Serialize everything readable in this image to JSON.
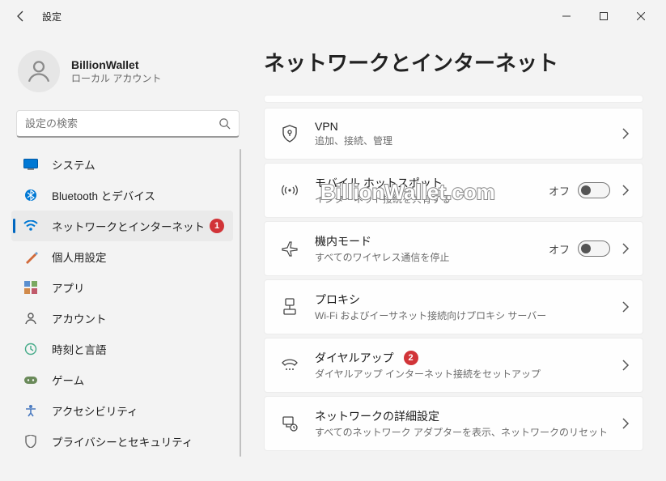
{
  "app": {
    "title": "設定"
  },
  "user": {
    "name": "BillionWallet",
    "type": "ローカル アカウント"
  },
  "search": {
    "placeholder": "設定の検索"
  },
  "sidebar": {
    "items": [
      {
        "label": "システム"
      },
      {
        "label": "Bluetooth とデバイス"
      },
      {
        "label": "ネットワークとインターネット",
        "selected": true,
        "marker": "1"
      },
      {
        "label": "個人用設定"
      },
      {
        "label": "アプリ"
      },
      {
        "label": "アカウント"
      },
      {
        "label": "時刻と言語"
      },
      {
        "label": "ゲーム"
      },
      {
        "label": "アクセシビリティ"
      },
      {
        "label": "プライバシーとセキュリティ"
      }
    ]
  },
  "page": {
    "title": "ネットワークとインターネット"
  },
  "cards": [
    {
      "title": "VPN",
      "desc": "追加、接続、管理"
    },
    {
      "title": "モバイル ホットスポット",
      "desc": "インターネット接続を共有する",
      "toggle": true,
      "toggle_label": "オフ"
    },
    {
      "title": "機内モード",
      "desc": "すべてのワイヤレス通信を停止",
      "toggle": true,
      "toggle_label": "オフ"
    },
    {
      "title": "プロキシ",
      "desc": "Wi-Fi およびイーサネット接続向けプロキシ サーバー"
    },
    {
      "title": "ダイヤルアップ",
      "desc": "ダイヤルアップ インターネット接続をセットアップ",
      "marker": "2"
    },
    {
      "title": "ネットワークの詳細設定",
      "desc": "すべてのネットワーク アダプターを表示、ネットワークのリセット"
    }
  ],
  "watermark": "BillionWallet.com"
}
